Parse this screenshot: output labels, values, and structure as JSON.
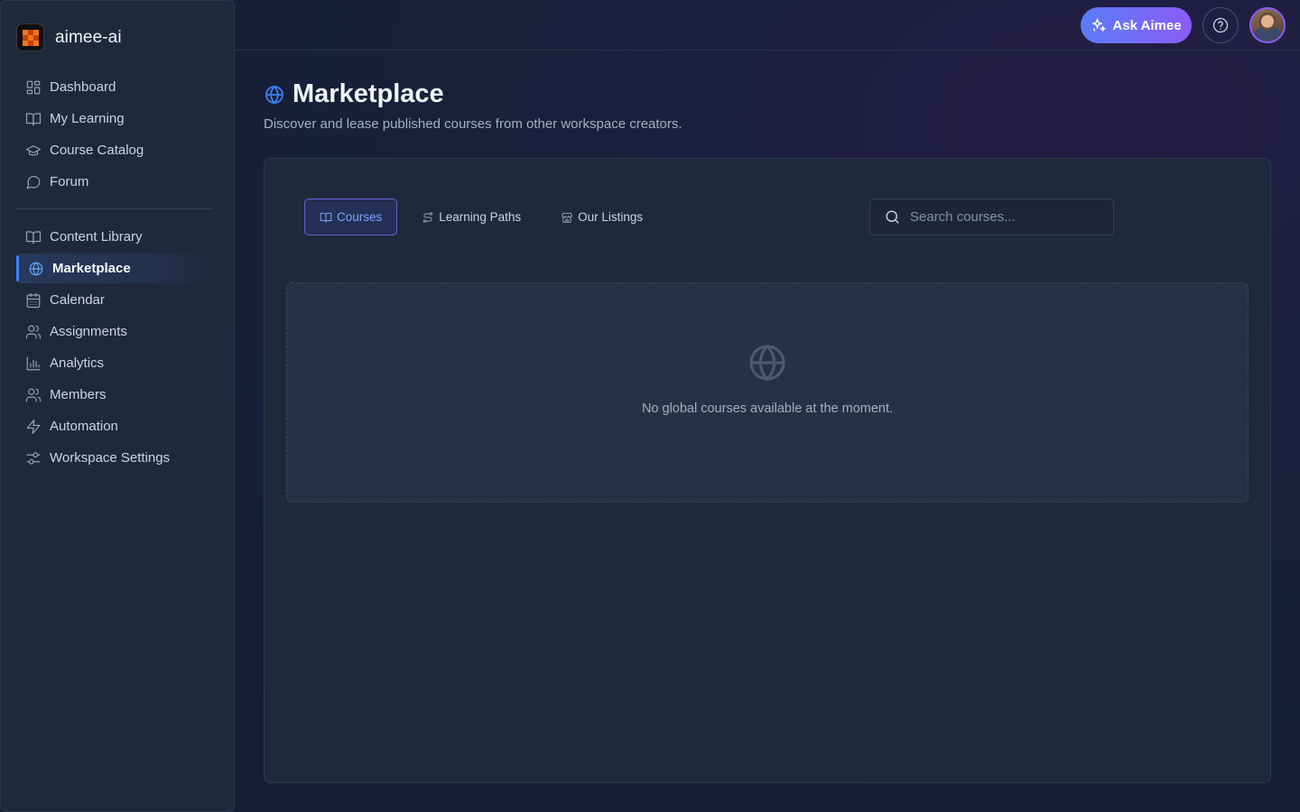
{
  "brand": {
    "name": "aimee-ai"
  },
  "sidebar": {
    "primary": [
      {
        "label": "Dashboard",
        "icon": "dashboard-icon"
      },
      {
        "label": "My Learning",
        "icon": "book-open-icon"
      },
      {
        "label": "Course Catalog",
        "icon": "graduation-cap-icon"
      },
      {
        "label": "Forum",
        "icon": "chat-bubble-icon"
      }
    ],
    "secondary": [
      {
        "label": "Content Library",
        "icon": "book-open-icon"
      },
      {
        "label": "Marketplace",
        "icon": "globe-icon",
        "active": true
      },
      {
        "label": "Calendar",
        "icon": "calendar-icon"
      },
      {
        "label": "Assignments",
        "icon": "users-icon"
      },
      {
        "label": "Analytics",
        "icon": "bar-chart-icon"
      },
      {
        "label": "Members",
        "icon": "users-icon"
      },
      {
        "label": "Automation",
        "icon": "lightning-icon"
      },
      {
        "label": "Workspace Settings",
        "icon": "sliders-icon"
      }
    ]
  },
  "topbar": {
    "ask_label": "Ask Aimee",
    "ask_icon": "sparkles-icon",
    "help_icon": "help-circle-icon",
    "avatar_icon": "user-avatar"
  },
  "page": {
    "title": "Marketplace",
    "title_icon": "globe-icon",
    "subtitle": "Discover and lease published courses from other workspace creators."
  },
  "tabs": [
    {
      "label": "Courses",
      "icon": "book-open-icon",
      "active": true
    },
    {
      "label": "Learning Paths",
      "icon": "route-icon"
    },
    {
      "label": "Our Listings",
      "icon": "store-icon"
    }
  ],
  "search": {
    "placeholder": "Search courses...",
    "value": ""
  },
  "empty_state": {
    "icon": "globe-icon",
    "message": "No global courses available at the moment."
  },
  "colors": {
    "accent": "#3b82f6",
    "ask_gradient_start": "#5b7cfa",
    "ask_gradient_end": "#8b5cf6",
    "sidebar_bg": "#1e293b"
  }
}
